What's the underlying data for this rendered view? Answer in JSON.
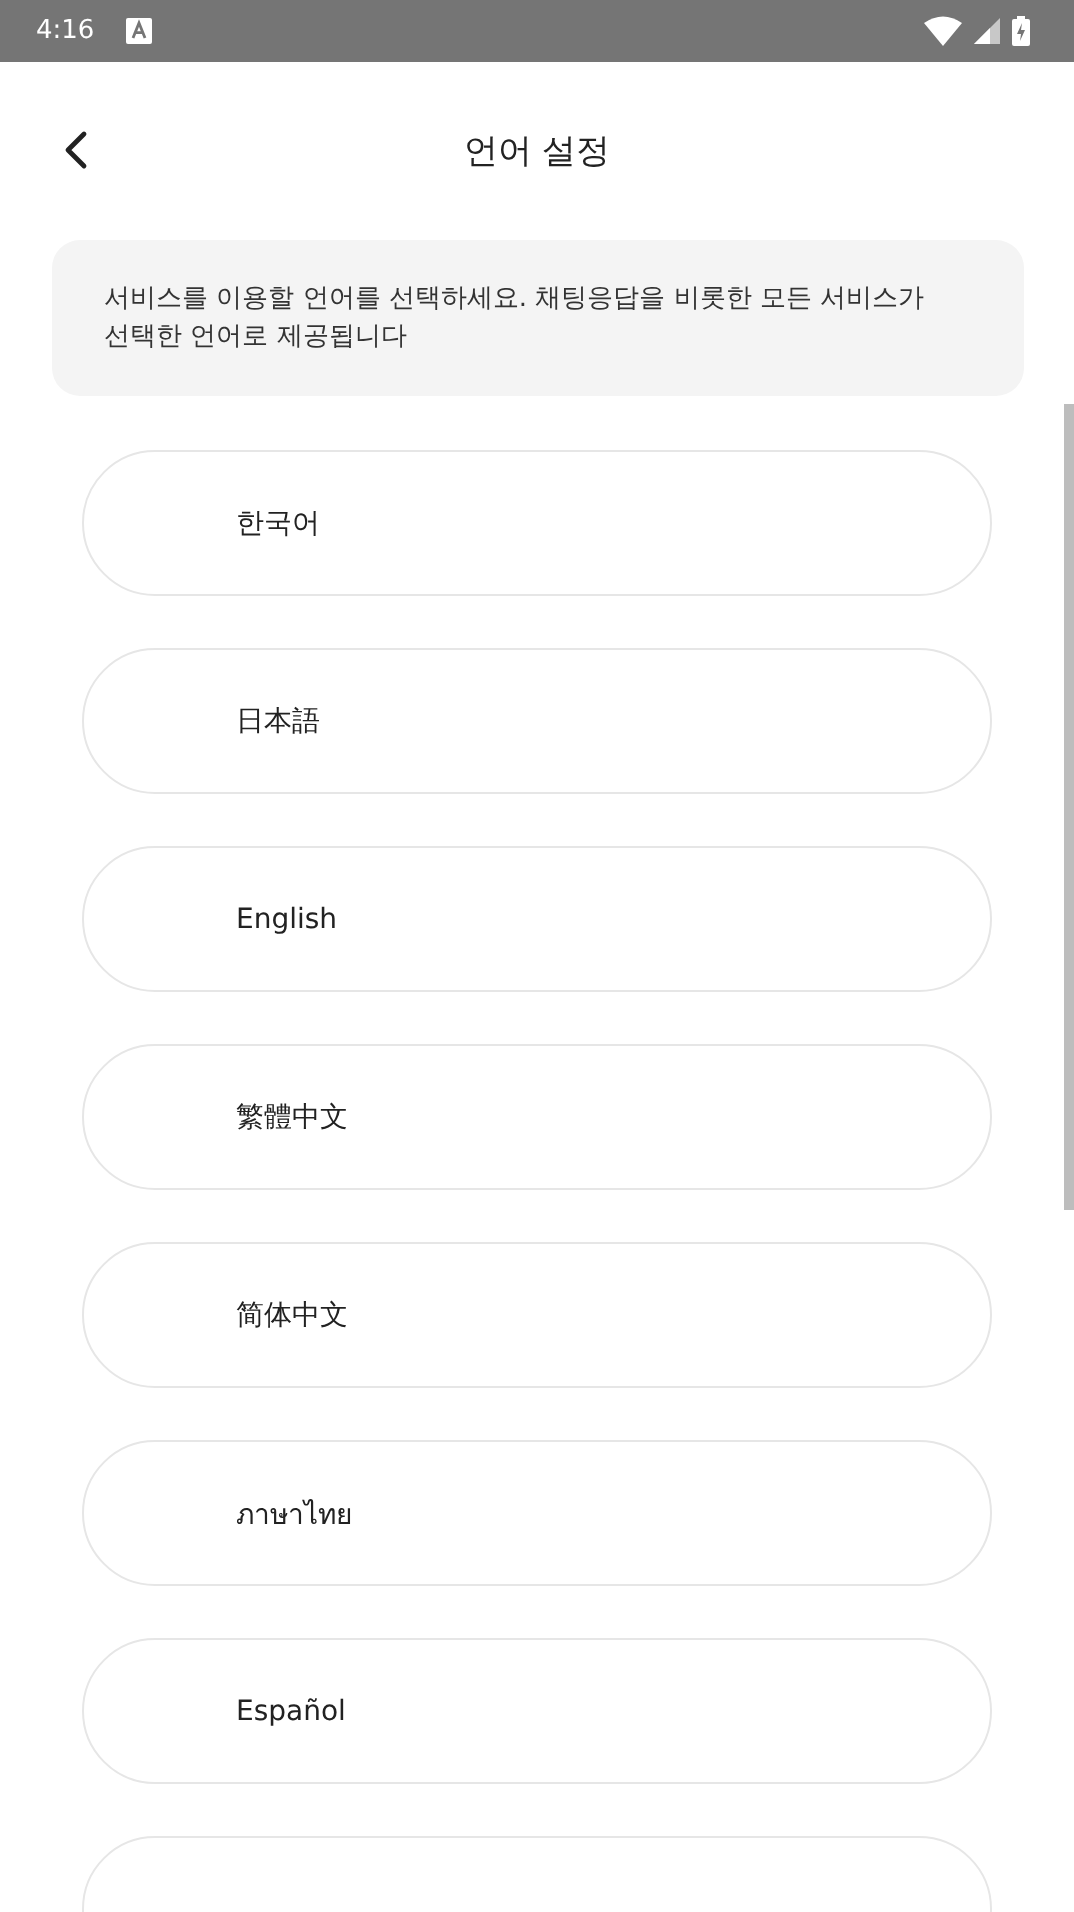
{
  "status_bar": {
    "time": "4:16"
  },
  "header": {
    "title": "언어 설정"
  },
  "notice": "서비스를 이용할 언어를 선택하세요. 채팅응답을 비롯한 모든 서비스가 선택한 언어로 제공됩니다",
  "languages": [
    {
      "kind": "option",
      "label": "한국어"
    },
    {
      "kind": "option",
      "label": "日本語"
    },
    {
      "kind": "option",
      "label": "English"
    },
    {
      "kind": "option",
      "label": "繁體中文"
    },
    {
      "kind": "option",
      "label": "简体中文"
    },
    {
      "kind": "option",
      "label": "ภาษาไทย"
    },
    {
      "kind": "option",
      "label": "Español"
    },
    {
      "kind": "cut"
    }
  ]
}
